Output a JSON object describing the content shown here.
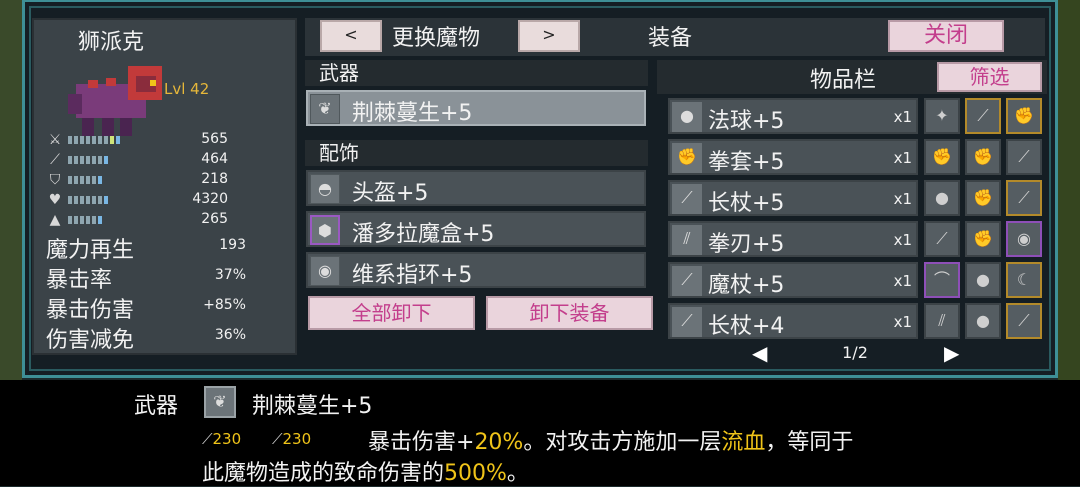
{
  "pet": {
    "name": "狮派克",
    "level": "Lvl 42",
    "icon_stats": [
      {
        "icon": "sword-icon",
        "value": "565"
      },
      {
        "icon": "staff-icon",
        "value": "464"
      },
      {
        "icon": "shield-icon",
        "value": "218"
      },
      {
        "icon": "heart-icon",
        "value": "4320"
      },
      {
        "icon": "speed-icon",
        "value": "265"
      }
    ],
    "text_stats": [
      {
        "label": "魔力再生",
        "value": "193"
      },
      {
        "label": "暴击率",
        "value": "37%"
      },
      {
        "label": "暴击伤害",
        "value": "+85%"
      },
      {
        "label": "伤害减免",
        "value": "36%"
      }
    ]
  },
  "header": {
    "prev": "<",
    "change_pet": "更换魔物",
    "next": ">",
    "equipment": "装备",
    "close": "关闭"
  },
  "weapon_section": {
    "title": "武器",
    "item": "荆棘蔓生+5"
  },
  "accessory_section": {
    "title": "配饰",
    "items": [
      "头盔+5",
      "潘多拉魔盒+5",
      "维系指环+5"
    ]
  },
  "actions": {
    "unequip_all": "全部卸下",
    "unequip": "卸下装备"
  },
  "inventory": {
    "title": "物品栏",
    "filter": "筛选",
    "items": [
      {
        "name": "法球+5",
        "count": "x1",
        "icon": "orb-icon"
      },
      {
        "name": "拳套+5",
        "count": "x1",
        "icon": "gauntlet-icon"
      },
      {
        "name": "长杖+5",
        "count": "x1",
        "icon": "staff-icon"
      },
      {
        "name": "拳刃+5",
        "count": "x1",
        "icon": "claw-icon"
      },
      {
        "name": "魔杖+5",
        "count": "x1",
        "icon": "wand-icon"
      },
      {
        "name": "长杖+4",
        "count": "x1",
        "icon": "staff-icon"
      }
    ],
    "page": "1/2",
    "prev_arrow": "◀",
    "next_arrow": "▶"
  },
  "description": {
    "slot": "武器",
    "name": "荆棘蔓生+5",
    "stat1": "230",
    "stat2": "230",
    "line1_a": "暴击伤害+",
    "line1_b": "20%",
    "line1_c": "。对攻击方施加一层",
    "line1_d": "流血",
    "line1_e": "，等同于",
    "line2_a": "此魔物造成的致命伤害的",
    "line2_b": "500%",
    "line2_c": "。"
  },
  "colors": {
    "accent_pink": "#c33e8c",
    "highlight": "#f0c419",
    "frame": "#3e8f96"
  }
}
